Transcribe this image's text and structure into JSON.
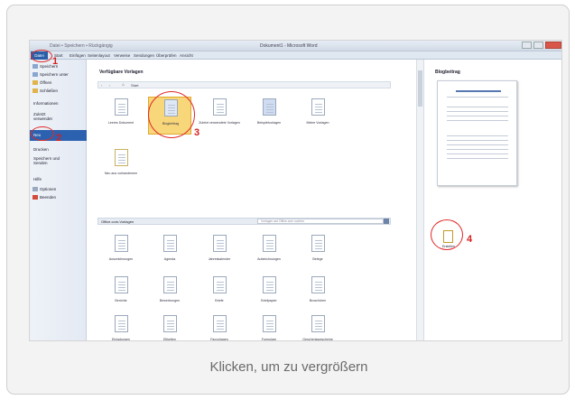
{
  "caption": "Klicken, um zu vergrößern",
  "word": {
    "window_title": "Dokument1 - Microsoft Word",
    "quick_access": "Datei  •  Speichern  •  Rückgängig",
    "tabs": [
      "Start",
      "Einfügen",
      "Seitenlayout",
      "Verweise",
      "Sendungen",
      "Überprüfen",
      "Ansicht"
    ],
    "file_tab": "Datei",
    "left_menu": [
      {
        "label": "Speichern",
        "icon": "save-icon"
      },
      {
        "label": "Speichern unter",
        "icon": "save-as-icon"
      },
      {
        "label": "Öffnen",
        "icon": "open-folder-icon"
      },
      {
        "label": "Schließen",
        "icon": "close-doc-icon"
      },
      {
        "label": "Informationen",
        "icon": ""
      },
      {
        "label": "Zuletzt verwendet",
        "icon": ""
      },
      {
        "label": "Neu",
        "icon": "",
        "active": true
      },
      {
        "label": "Drucken",
        "icon": ""
      },
      {
        "label": "Speichern und Senden",
        "icon": ""
      },
      {
        "label": "Hilfe",
        "icon": ""
      },
      {
        "label": "Optionen",
        "icon": "options-icon"
      },
      {
        "label": "Beenden",
        "icon": "exit-icon"
      }
    ],
    "templates_heading": "Verfügbare Vorlagen",
    "nav_home": "Start",
    "top_templates": [
      "Leeres Dokument",
      "Blogbeitrag",
      "Zuletzt verwendete Vorlagen",
      "Beispielvorlagen",
      "Meine Vorlagen",
      "Neu aus vorhandenem"
    ],
    "office_section": "Office.com-Vorlagen",
    "search_placeholder": "Vorlagen auf Office.com suchen",
    "office_templates": [
      [
        "Auszeichnungen",
        "Agenda",
        "Jahreskalender",
        "Aufzeichnungen",
        "Belege"
      ],
      [
        "Berichte",
        "Bewerbungen",
        "Briefe",
        "Briefpapier",
        "Broschüren"
      ],
      [
        "Einladungen",
        "Etiketten",
        "Faxvorlagen",
        "Formulare",
        "Geschenkgutscheine"
      ]
    ],
    "preview_heading": "Blogbeitrag",
    "create_label": "Erstellen"
  },
  "markers": [
    "1",
    "2",
    "3",
    "4"
  ],
  "colors": {
    "marker": "#d61f1f",
    "accent": "#2c61b0",
    "selected": "#f8d67a"
  }
}
